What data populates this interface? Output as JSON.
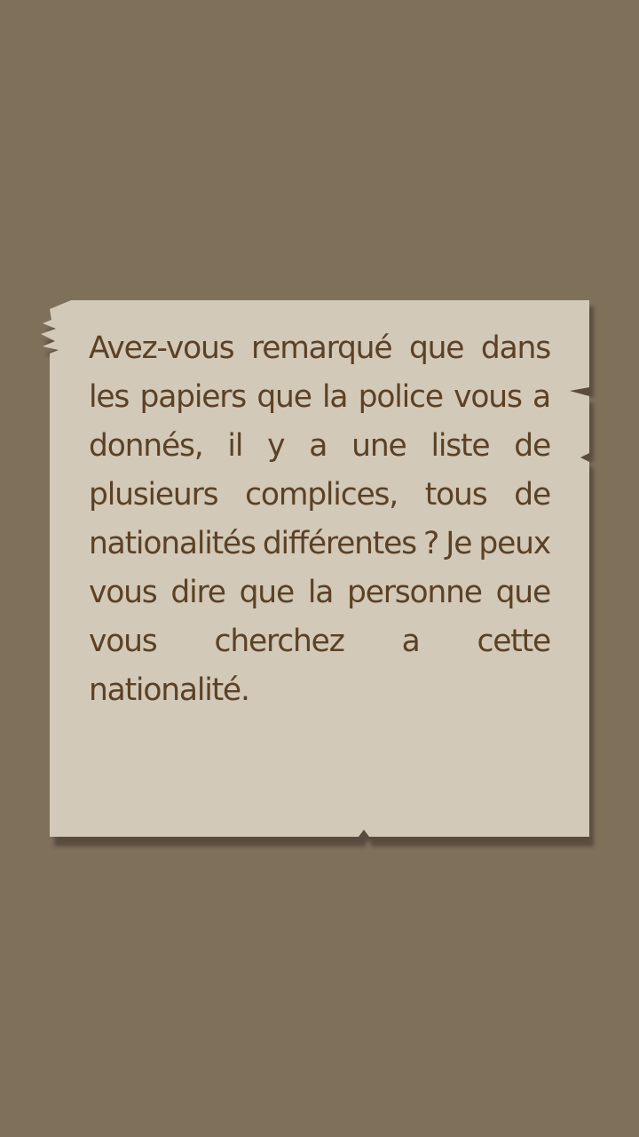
{
  "theme": {
    "background": "#7f705a",
    "paper": "#d3c9b8",
    "text": "#5b4126",
    "shadow": "#3b3226"
  },
  "note": {
    "text": "Avez-vous remarqué que dans les papiers que la police vous a donnés, il y a une liste de plusieurs complices, tous de nationalités différentes ? Je peux vous dire que la personne que vous cherchez a cette nationalité."
  }
}
